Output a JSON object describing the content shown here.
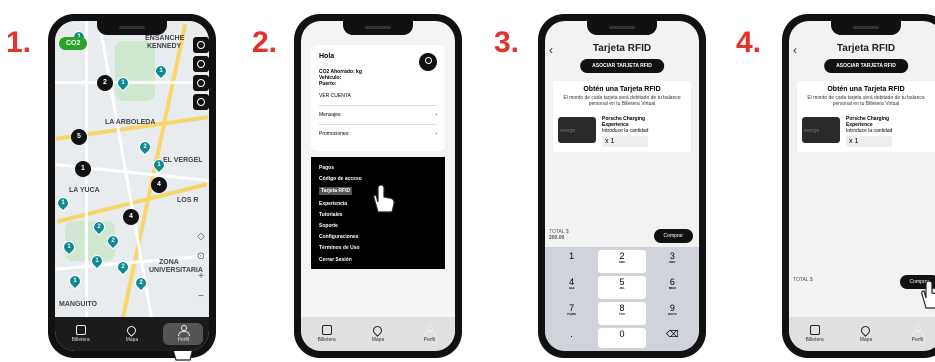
{
  "steps": [
    "1.",
    "2.",
    "3.",
    "4."
  ],
  "tabbar": {
    "wallet": "Billetera",
    "map": "Mapa",
    "profile": "Perfil"
  },
  "phone1": {
    "co2_badge": "CO2",
    "labels": {
      "ensanche": "ENSANCHE",
      "kennedy": "KENNEDY",
      "arboleda": "LA ARBOLEDA",
      "yuca": "LA YUCA",
      "vergel": "EL VERGEL",
      "zona": "ZONA",
      "universitaria": "UNIVERSITARIA",
      "manguito": "MANGUITO",
      "rios": "LOS R"
    },
    "clusters": [
      "2",
      "5",
      "1",
      "4",
      "4"
    ],
    "pins": [
      "1",
      "1",
      "1",
      "2",
      "1",
      "1",
      "2",
      "2",
      "1",
      "1",
      "2",
      "2",
      "1"
    ]
  },
  "phone2": {
    "greeting": "Hola",
    "co2": "CO2 Ahorrado:  kg",
    "vehicle": "Vehículo:",
    "port": "Puerto:",
    "account": "VER CUENTA",
    "messages": "Mensajes:",
    "promotions": "Promociones:",
    "menu": [
      "Pagos",
      "Código de acceso",
      "Tarjeta RFID",
      "Experiencia",
      "Tutoriales",
      "Soporte",
      "Configuraciones",
      "Términos de Uso",
      "Cerrar Sesión"
    ]
  },
  "rfid": {
    "title": "Tarjeta RFID",
    "associate": "ASOCIAR TARJETA RFID",
    "get_card": "Obtén una Tarjeta RFID",
    "desc": "El monto de cada tarjeta será debitado de tu balance personal en tu Billetera Virtual",
    "product_line1": "Porsche Charging",
    "product_line2": "Experience",
    "qty_hint": "Introduce la cantidad",
    "qty": "x 1",
    "card_brand": "evergo",
    "total": "TOTAL $",
    "total_value": "200.00",
    "buy": "Comprar"
  },
  "keypad": [
    {
      "n": "1",
      "l": ""
    },
    {
      "n": "2",
      "l": "ABC"
    },
    {
      "n": "3",
      "l": "DEF"
    },
    {
      "n": "4",
      "l": "GHI"
    },
    {
      "n": "5",
      "l": "JKL"
    },
    {
      "n": "6",
      "l": "MNO"
    },
    {
      "n": "7",
      "l": "PQRS"
    },
    {
      "n": "8",
      "l": "TUV"
    },
    {
      "n": "9",
      "l": "WXYZ"
    },
    {
      "n": ".",
      "l": ""
    },
    {
      "n": "0",
      "l": ""
    },
    {
      "n": "⌫",
      "l": ""
    }
  ],
  "colors": {
    "step": "#e4322b",
    "pin": "#0f8a92",
    "co2": "#2aa52a"
  }
}
